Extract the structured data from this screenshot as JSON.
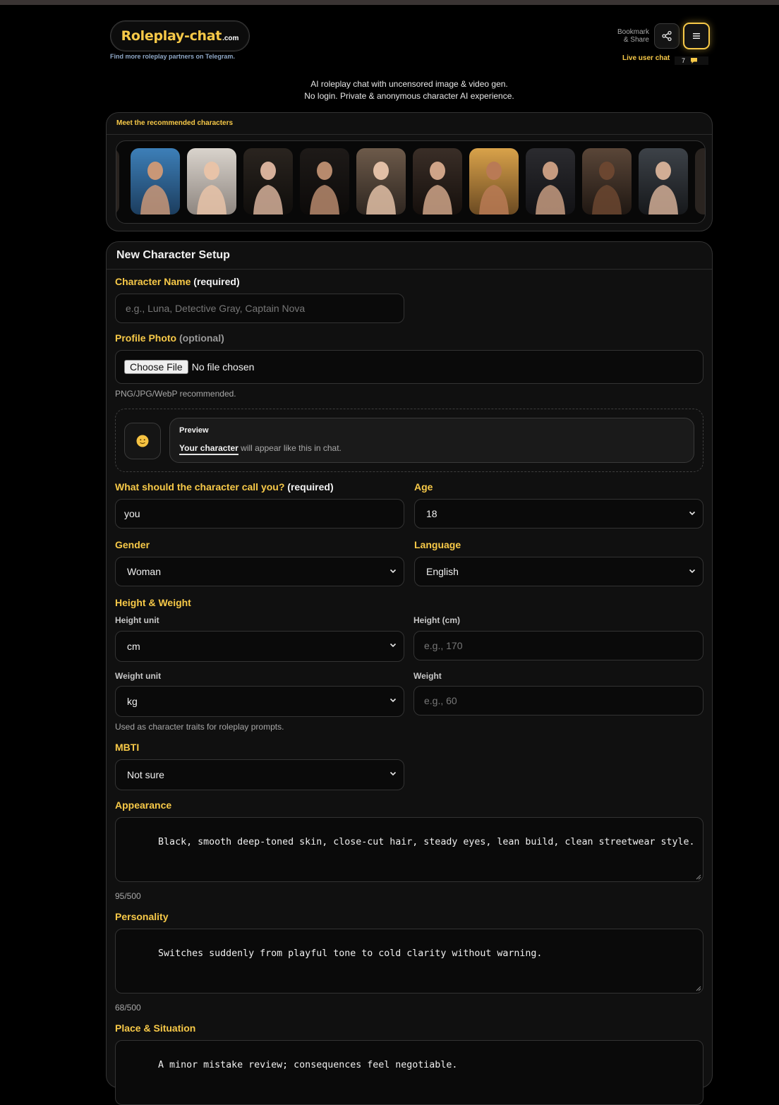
{
  "header": {
    "logo_main": "Roleplay-chat",
    "logo_suffix": ".com",
    "tagline": "Find more roleplay partners on Telegram.",
    "bookmark_line1": "Bookmark",
    "bookmark_line2": "& Share",
    "live_chat_label": "Live user chat",
    "live_chat_count": "7"
  },
  "intro": {
    "line1": "AI roleplay chat with uncensored image & video gen.",
    "line2": "No login. Private & anonymous character AI experience."
  },
  "recommended": {
    "title": "Meet the recommended characters",
    "count": 10
  },
  "form": {
    "title": "New Character Setup",
    "name_label": "Character Name",
    "name_suffix": "(required)",
    "name_placeholder": "e.g., Luna, Detective Gray, Captain Nova",
    "photo_label": "Profile Photo",
    "photo_suffix": "(optional)",
    "choose_file": "Choose File",
    "no_file": "No file chosen",
    "photo_hint": "PNG/JPG/WebP recommended.",
    "preview_title": "Preview",
    "preview_name": "Your character",
    "preview_text": " will appear like this in chat.",
    "preview_avatar_icon": "smiley-face-icon",
    "call_you_label": "What should the character call you?",
    "call_you_suffix": "(required)",
    "call_you_value": "you",
    "age_label": "Age",
    "age_value": "18",
    "gender_label": "Gender",
    "gender_value": "Woman",
    "language_label": "Language",
    "language_value": "English",
    "hw_label": "Height & Weight",
    "height_unit_label": "Height unit",
    "height_unit_value": "cm",
    "height_label": "Height (cm)",
    "height_placeholder": "e.g., 170",
    "weight_unit_label": "Weight unit",
    "weight_unit_value": "kg",
    "weight_label": "Weight",
    "weight_placeholder": "e.g., 60",
    "hw_hint": "Used as character traits for roleplay prompts.",
    "mbti_label": "MBTI",
    "mbti_value": "Not sure",
    "appearance_label": "Appearance",
    "appearance_value": "Black, smooth deep-toned skin, close-cut hair, steady eyes, lean build, clean streetwear style.",
    "appearance_count": "95/500",
    "personality_label": "Personality",
    "personality_value": "Switches suddenly from playful tone to cold clarity without warning.",
    "personality_count": "68/500",
    "place_label": "Place & Situation",
    "place_value": "A minor mistake review; consequences feel negotiable."
  },
  "colors": {
    "accent": "#f7c948",
    "background": "#000000",
    "panel": "#101010",
    "field": "#0a0a0a"
  }
}
